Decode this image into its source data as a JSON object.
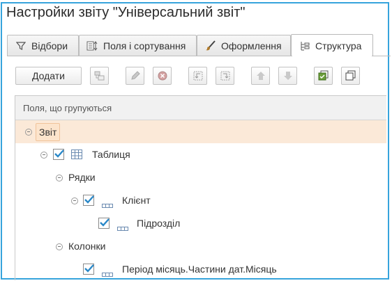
{
  "window": {
    "title": "Настройки звіту \"Універсальний звіт\""
  },
  "tabs": [
    {
      "label": "Відбори",
      "icon": "filter-icon"
    },
    {
      "label": "Поля і сортування",
      "icon": "fields-sort-icon"
    },
    {
      "label": "Оформлення",
      "icon": "brush-icon"
    },
    {
      "label": "Структура",
      "icon": "structure-icon",
      "active": true
    }
  ],
  "toolbar": {
    "add_label": "Додати",
    "icons": [
      "add-group-icon",
      "edit-icon",
      "delete-icon",
      "move-left-icon",
      "move-right-icon",
      "move-up-icon",
      "move-down-icon",
      "check-all-icon",
      "uncheck-all-icon"
    ]
  },
  "tree": {
    "header": "Поля, що групуються",
    "rows": [
      {
        "label": "Звіт",
        "selected": true,
        "checked": null,
        "icon": null
      },
      {
        "label": "Таблиця",
        "checked": true,
        "icon": "table-icon"
      },
      {
        "label": "Рядки",
        "checked": null,
        "icon": null
      },
      {
        "label": "Клієнт",
        "checked": true,
        "icon": "field-icon"
      },
      {
        "label": "Підрозділ",
        "checked": true,
        "icon": "field-icon"
      },
      {
        "label": "Колонки",
        "checked": null,
        "icon": null
      },
      {
        "label": "Період місяць.Частини дат.Місяць",
        "checked": true,
        "icon": "field-icon"
      }
    ]
  },
  "colors": {
    "accent_border": "#36a4dc",
    "selection": "#fbe9d8",
    "check": "#2a88c8"
  }
}
